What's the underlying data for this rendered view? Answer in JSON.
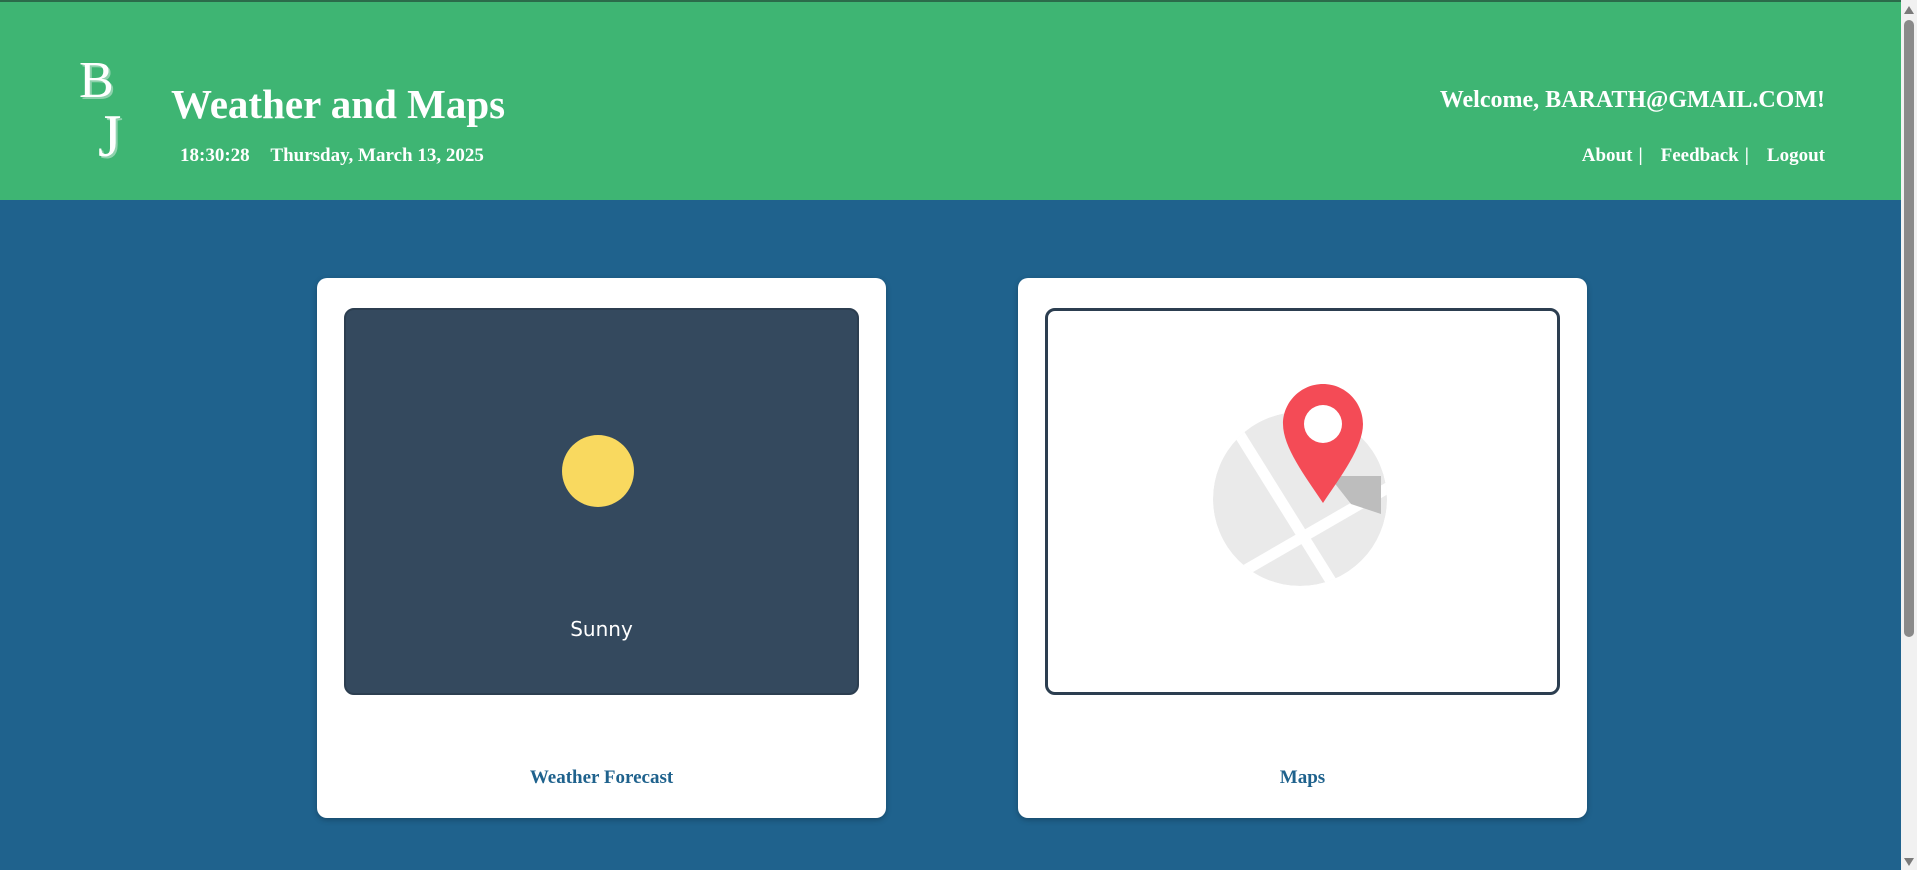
{
  "header": {
    "logo_text": "BJ",
    "title": "Weather and Maps",
    "time": "18:30:28",
    "date": "Thursday, March 13, 2025",
    "welcome": "Welcome, BARATH@GMAIL.COM!",
    "nav": {
      "about": "About",
      "feedback": "Feedback",
      "logout": "Logout",
      "separator": "|"
    }
  },
  "cards": {
    "weather": {
      "condition": "Sunny",
      "icon": "sun-icon",
      "link_label": "Weather Forecast"
    },
    "maps": {
      "icon": "map-pin-icon",
      "link_label": "Maps"
    }
  },
  "colors": {
    "header_bg": "#3eb573",
    "page_bg": "#1f628d",
    "weather_panel": "#34495e",
    "sun": "#f9d95f",
    "pin": "#f44b56",
    "link": "#1f628d"
  }
}
